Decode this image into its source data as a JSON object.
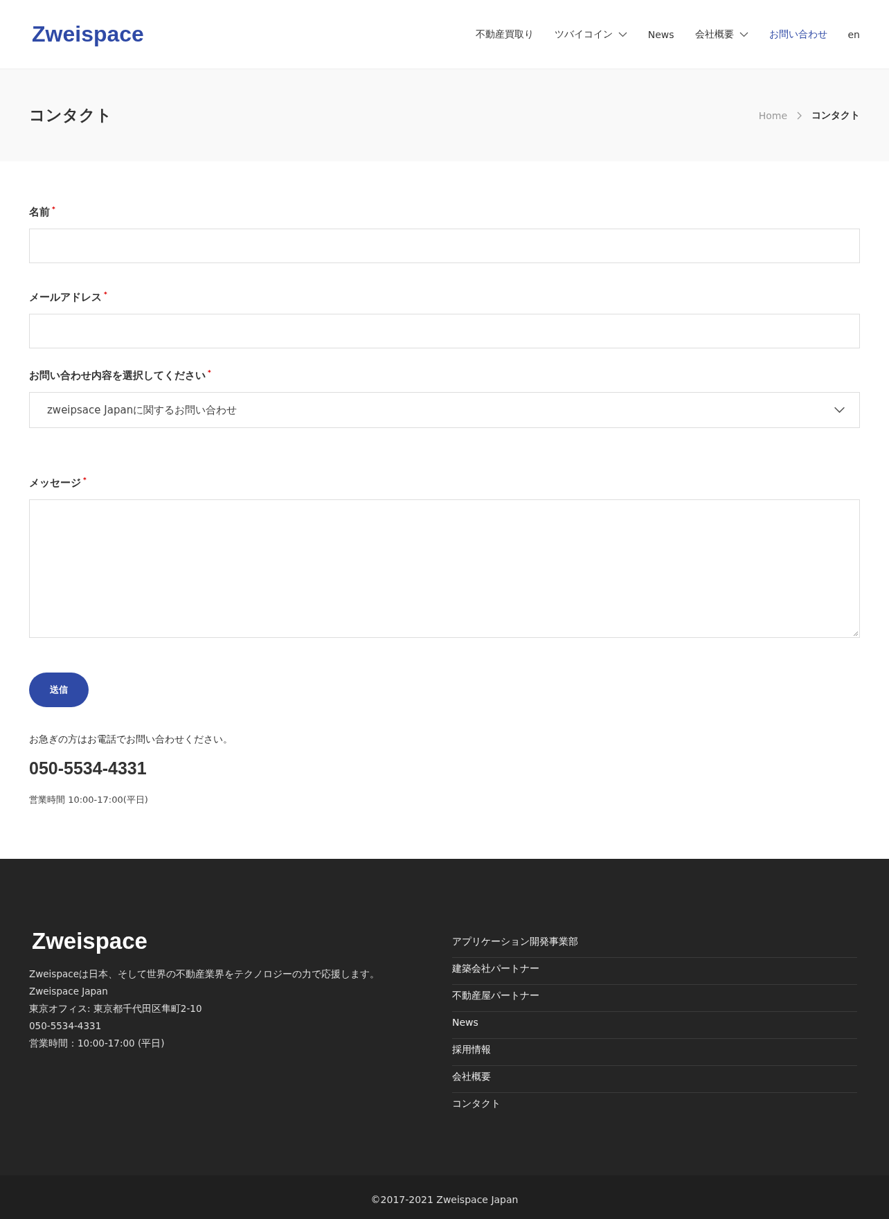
{
  "header": {
    "logo": "Zweispace",
    "nav": [
      {
        "label": "不動産買取り",
        "selected": false,
        "dropdown": false
      },
      {
        "label": "ツバイコイン",
        "selected": false,
        "dropdown": true
      },
      {
        "label": "News",
        "selected": false,
        "dropdown": false
      },
      {
        "label": "会社概要",
        "selected": false,
        "dropdown": true
      },
      {
        "label": "お問い合わせ",
        "selected": true,
        "dropdown": false
      },
      {
        "label": "en",
        "selected": false,
        "dropdown": false
      }
    ]
  },
  "page_title": {
    "title": "コンタクト",
    "breadcrumb": [
      "Home",
      "コンタクト"
    ]
  },
  "form": {
    "fields": [
      {
        "kind": "text",
        "label": "名前",
        "required_mark": "*"
      },
      {
        "kind": "text",
        "label": "メールアドレス",
        "required_mark": "*"
      },
      {
        "kind": "select",
        "label": "お問い合わせ内容を選択してください",
        "required_mark": "*",
        "value": "zweipsace Japanに関するお問い合わせ"
      },
      {
        "kind": "textarea",
        "label": "メッセージ",
        "required_mark": "*"
      }
    ],
    "submit": "送信"
  },
  "contact": {
    "note": "お急ぎの方はお電話でお問い合わせください。",
    "phone": "050-5534-4331",
    "hours": "営業時間 10:00-17:00(平日)"
  },
  "footer": {
    "logo": "Zweispace",
    "lines": [
      "Zweispaceは日本、そして世界の不動産業界をテクノロジーの力で応援します。",
      "Zweispace Japan",
      "東京オフィス: 東京都千代田区隼町2-10",
      "050-5534-4331",
      "営業時間：10:00-17:00 (平日)"
    ],
    "links": [
      "アプリケーション開発事業部",
      "建築会社パートナー",
      "不動産屋パートナー",
      "News",
      "採用情報",
      "会社概要",
      "コンタクト"
    ],
    "copyright": "©2017-2021  Zweispace Japan"
  }
}
